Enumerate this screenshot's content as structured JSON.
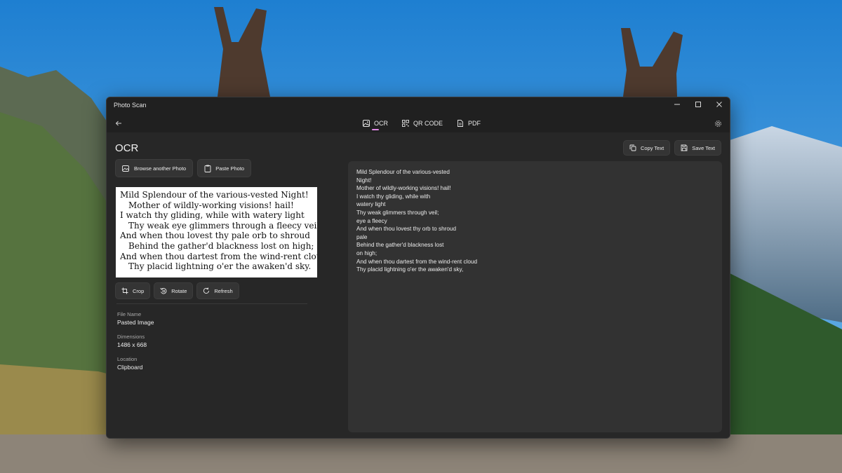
{
  "window": {
    "app_title": "Photo Scan"
  },
  "tabs": [
    {
      "label": "OCR",
      "icon": "image-icon",
      "active": true
    },
    {
      "label": "QR CODE",
      "icon": "qr-code-icon",
      "active": false
    },
    {
      "label": "PDF",
      "icon": "pdf-icon",
      "active": false
    }
  ],
  "page": {
    "title": "OCR",
    "copy_text_label": "Copy Text",
    "save_text_label": "Save Text",
    "browse_label": "Browse another Photo",
    "paste_label": "Paste Photo"
  },
  "preview": {
    "lines": [
      "Mild Splendour of the various-vested Night!",
      "Mother of wildly-working visions! hail!",
      "I watch thy gliding, while with watery light",
      "Thy weak eye glimmers through a fleecy veil;",
      "And when thou lovest thy pale orb to shroud",
      "Behind the gather'd blackness lost on high;",
      "And when thou dartest from the wind-rent cloud",
      "Thy placid lightning o'er the awaken'd sky."
    ]
  },
  "tools": {
    "crop_label": "Crop",
    "rotate_label": "Rotate",
    "refresh_label": "Refresh"
  },
  "file_info": {
    "file_name_label": "File Name",
    "file_name": "Pasted Image",
    "dimensions_label": "Dimensions",
    "dimensions": "1486 x 668",
    "location_label": "Location",
    "location": "Clipboard"
  },
  "ocr_text": {
    "lines": [
      "Mild Splendour of the various-vested",
      "Night!",
      "Mother of wildly-working visions! hail!",
      "I watch thy gliding, while with",
      "watery light",
      "Thy weak glimmers through veil;",
      "eye a fleecy",
      "And when thou lovest thy orb to shroud",
      "pale",
      "Behind the gather'd blackness lost",
      "on high;",
      "And when thou dartest from the wind-rent cloud",
      "Thy placid lightning o'er the awaken'd sky,"
    ]
  },
  "colors": {
    "accent": "#e189e6",
    "window_bg": "#202020",
    "content_bg": "#272727",
    "text_panel_bg": "#323232"
  }
}
